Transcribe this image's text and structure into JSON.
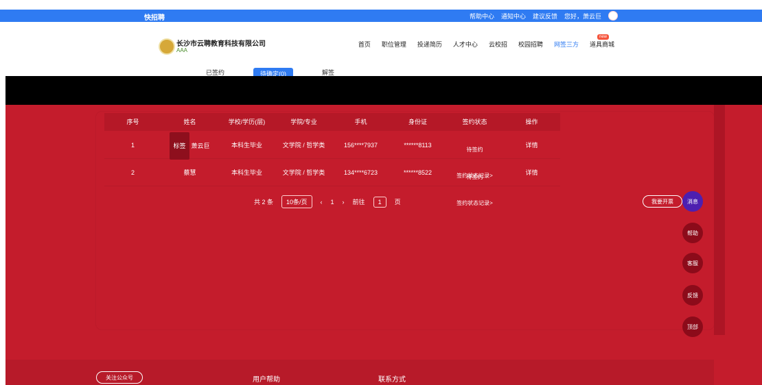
{
  "topbar": {
    "logo": "快招聘",
    "links": [
      "帮助中心",
      "通知中心",
      "建议反馈",
      "您好，萧云巨"
    ]
  },
  "header": {
    "company": "长沙市云聘教育科技有限公司",
    "badge": "AAA",
    "nav": [
      "首页",
      "职位管理",
      "投递简历",
      "人才中心",
      "云校招",
      "校园招聘",
      "网签三方",
      "道具商城"
    ],
    "new": "new"
  },
  "subtabs": {
    "tab1": "已签约",
    "tab2": "待确定(0)",
    "tab3": "解签"
  },
  "table": {
    "headers": [
      "序号",
      "姓名",
      "学校/学历(层)",
      "学院/专业",
      "手机",
      "身份证",
      "签约状态",
      "操作"
    ],
    "rows": [
      {
        "idx": "1",
        "tag": "标签",
        "name": "萧云巨",
        "edu": "本科生毕业",
        "major": "文学院 / 哲学类",
        "phone": "156****7937",
        "idcard": "******8113",
        "status": "待签约",
        "status_link": "签约状态记录>",
        "op": "详情"
      },
      {
        "idx": "2",
        "tag": "",
        "name": "蔡慧",
        "edu": "本科生毕业",
        "major": "文学院 / 哲学类",
        "phone": "134****6723",
        "idcard": "******8522",
        "status": "待签约",
        "status_link": "签约状态记录>",
        "op": "详情"
      }
    ]
  },
  "pagination": {
    "total": "共 2 条",
    "size": "10条/页",
    "page": "1",
    "goto": "前往",
    "goto_val": "1",
    "unit": "页"
  },
  "floating": {
    "open": "我要开票",
    "b1": "消息",
    "b2": "帮助",
    "b3": "客服",
    "b4": "反馈",
    "b5": "顶部"
  },
  "footer": {
    "gz": "关注公众号",
    "help": "用户帮助",
    "contact": "联系方式"
  }
}
